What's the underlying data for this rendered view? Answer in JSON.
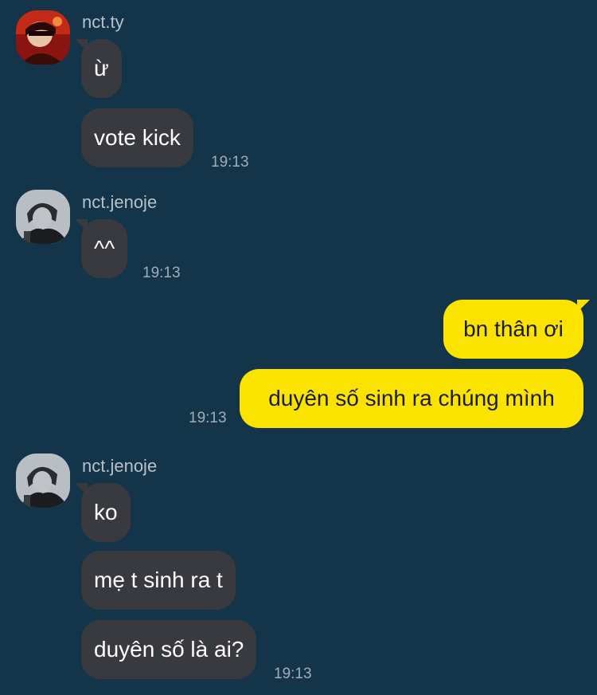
{
  "theme": {
    "background": "#143449",
    "incoming_bubble": "#383a3f",
    "outgoing_bubble": "#fbe300"
  },
  "groups": [
    {
      "sender": "nct.ty",
      "avatar_icon": "user-avatar-red-photo",
      "messages": [
        "ừ",
        "vote kick"
      ],
      "time": "19:13"
    },
    {
      "sender": "nct.jenoje",
      "avatar_icon": "user-avatar-grayscale-photo",
      "messages": [
        "^^"
      ],
      "time": "19:13"
    },
    {
      "sender": "me",
      "outgoing": true,
      "messages": [
        "bn thân ơi",
        "duyên số sinh ra chúng mình"
      ],
      "time": "19:13"
    },
    {
      "sender": "nct.jenoje",
      "avatar_icon": "user-avatar-grayscale-photo",
      "messages": [
        "ko",
        "mẹ t sinh ra t",
        "duyên số là ai?"
      ],
      "time": "19:13"
    }
  ]
}
